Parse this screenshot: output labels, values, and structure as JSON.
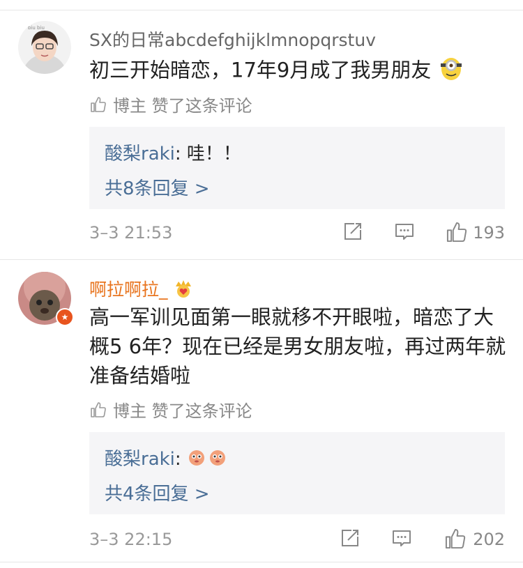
{
  "comments": [
    {
      "username": "SX的日常abcdefghijklmnopqrstuv",
      "content": "初三开始暗恋，17年9月成了我男朋友",
      "content_emoji": "minion-emoji",
      "liked_by_label": "博主 赞了这条评论",
      "reply": {
        "name": "酸梨raki",
        "text": ": 哇！！",
        "more": "共8条回复 >"
      },
      "time": "3–3 21:53",
      "likes": "193"
    },
    {
      "username": "啊拉啊拉_",
      "username_emoji": "crown-heart-emoji",
      "content": "高一军训见面第一眼就移不开眼啦，暗恋了大概5 6年？现在已经是男女朋友啦，再过两年就准备结婚啦",
      "liked_by_label": "博主 赞了这条评论",
      "reply": {
        "name": "酸梨raki",
        "text": ": ",
        "text_emoji": "pink-creature-emoji",
        "more": "共4条回复 >"
      },
      "time": "3–3 22:15",
      "likes": "202"
    }
  ],
  "colors": {
    "link": "#4a6e96",
    "orange_name": "#e8741e",
    "reply_bg": "#f5f5f7",
    "meta": "#888888"
  }
}
